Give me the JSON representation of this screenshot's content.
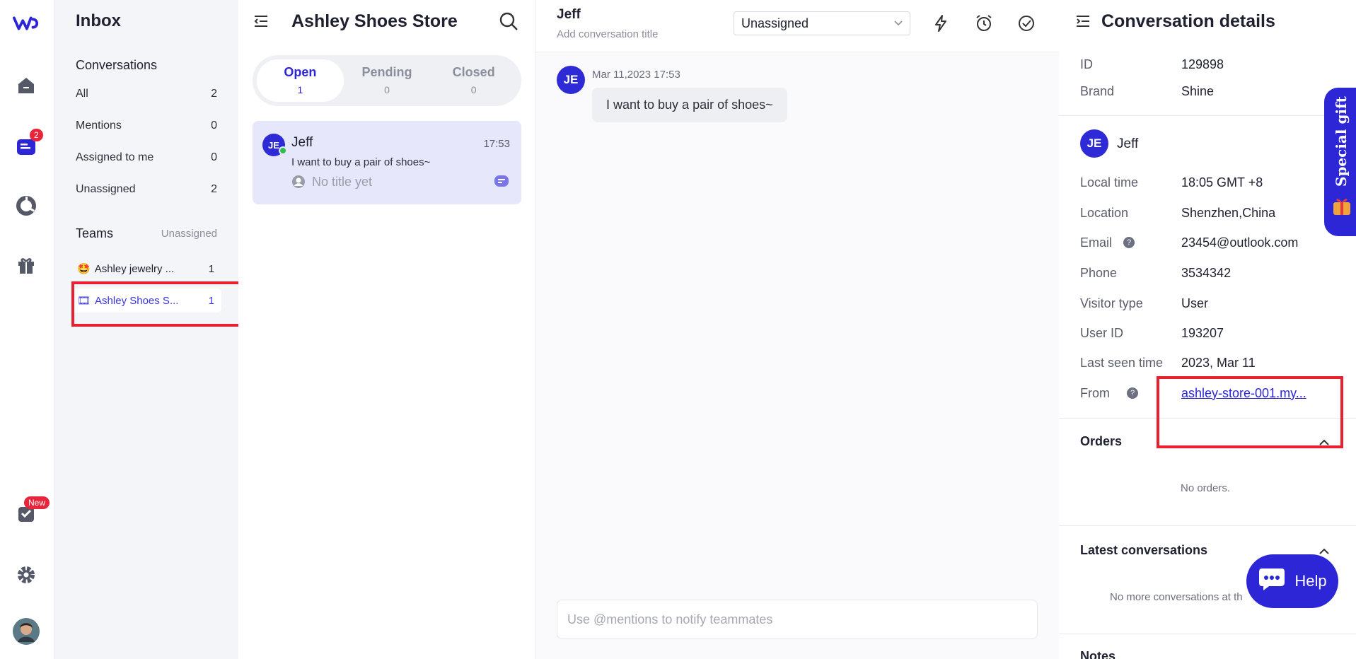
{
  "rail": {
    "inbox_badge": "2",
    "new_badge": "New"
  },
  "inbox": {
    "title": "Inbox",
    "conversations_label": "Conversations",
    "items": [
      {
        "label": "All",
        "count": "2"
      },
      {
        "label": "Mentions",
        "count": "0"
      },
      {
        "label": "Assigned to me",
        "count": "0"
      },
      {
        "label": "Unassigned",
        "count": "2"
      }
    ],
    "teams_label": "Teams",
    "teams_sub": "Unassigned",
    "teams": [
      {
        "label": "Ashley jewelry ...",
        "count": "1",
        "emoji": "🤩"
      },
      {
        "label": "Ashley Shoes S...",
        "count": "1",
        "emoji": "🎞"
      }
    ]
  },
  "list": {
    "title": "Ashley Shoes Store",
    "tabs": [
      {
        "label": "Open",
        "count": "1"
      },
      {
        "label": "Pending",
        "count": "0"
      },
      {
        "label": "Closed",
        "count": "0"
      }
    ],
    "card": {
      "initials": "JE",
      "name": "Jeff",
      "time": "17:53",
      "preview": "I want to buy a pair of shoes~",
      "title": "No title yet"
    }
  },
  "chat": {
    "name": "Jeff",
    "subtitle": "Add conversation title",
    "assignee": "Unassigned",
    "message": {
      "initials": "JE",
      "timestamp": "Mar 11,2023 17:53",
      "text": "I want to buy a pair of shoes~"
    },
    "composer_placeholder": "Use @mentions to notify teammates"
  },
  "details": {
    "title": "Conversation details",
    "id_label": "ID",
    "id_value": "129898",
    "brand_label": "Brand",
    "brand_value": "Shine",
    "contact_initials": "JE",
    "contact_name": "Jeff",
    "fields": [
      {
        "k": "Local time",
        "v": "18:05 GMT +8"
      },
      {
        "k": "Location",
        "v": "Shenzhen,China"
      },
      {
        "k": "Email",
        "v": "23454@outlook.com",
        "help": true
      },
      {
        "k": "Phone",
        "v": "3534342"
      },
      {
        "k": "Visitor type",
        "v": "User"
      },
      {
        "k": "User ID",
        "v": "193207"
      },
      {
        "k": "Last seen time",
        "v": "2023, Mar 11"
      }
    ],
    "from_label": "From",
    "from_value": "ashley-store-001.my...",
    "orders_label": "Orders",
    "no_orders": "No orders.",
    "latest_label": "Latest conversations",
    "no_more": "No more conversations at th",
    "notes_label": "Notes",
    "special_gift": "Special gift",
    "help_label": "Help"
  },
  "colors": {
    "accent": "#2c26d6",
    "highlight_box": "#e8202f"
  }
}
